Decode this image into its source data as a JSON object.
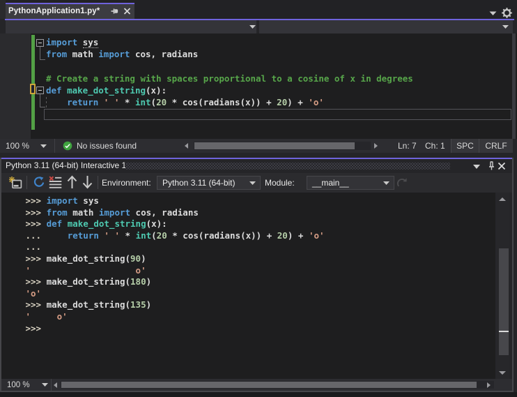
{
  "colors": {
    "accent_purple": "#6f63dc",
    "editor_background": "#1e1e1f",
    "chrome_background": "#252528",
    "keyword_blue": "#569cd6",
    "comment_green": "#57a64a",
    "string_salmon": "#d69d85",
    "number_green": "#b5cea8",
    "builtin_teal": "#4ec9b0",
    "track_changes_saved_green": "#53a045",
    "track_changes_pending_orange": "#cda53a",
    "issues_check_green": "#3fa33f"
  },
  "tab": {
    "title": "PythonApplication1.py*",
    "pin_icon": "pin-horizontal",
    "close_icon": "close-x"
  },
  "document_well": {
    "dropdown_icon": "chevron-down",
    "settings_icon": "gear"
  },
  "nav_bar": {
    "left_dropdown_value": "",
    "right_dropdown_value": ""
  },
  "editor": {
    "lines": [
      {
        "t": [
          [
            "kw",
            "import"
          ],
          [
            "pl",
            " "
          ],
          [
            "un",
            "sys"
          ]
        ]
      },
      {
        "t": [
          [
            "kw",
            "from"
          ],
          [
            "pl",
            " math "
          ],
          [
            "kw",
            "import"
          ],
          [
            "pl",
            " cos, radians"
          ]
        ]
      },
      {
        "t": []
      },
      {
        "t": [
          [
            "cm",
            "# Create a string with spaces proportional to a cosine of x in degrees"
          ]
        ]
      },
      {
        "t": [
          [
            "kw",
            "def"
          ],
          [
            "pl",
            " "
          ],
          [
            "fn",
            "make_dot_string"
          ],
          [
            "pl",
            "(x):"
          ]
        ]
      },
      {
        "t": [
          [
            "pl",
            "    "
          ],
          [
            "kw",
            "return"
          ],
          [
            "pl",
            " "
          ],
          [
            "str",
            "' '"
          ],
          [
            "pl",
            " * "
          ],
          [
            "fn",
            "int"
          ],
          [
            "pl",
            "("
          ],
          [
            "num",
            "20"
          ],
          [
            "pl",
            " * cos(radians(x)) + "
          ],
          [
            "num",
            "20"
          ],
          [
            "pl",
            ") + "
          ],
          [
            "str",
            "'o'"
          ]
        ]
      },
      {
        "t": []
      }
    ],
    "current_line_index": 7
  },
  "editor_status": {
    "zoom": "100 %",
    "issues": "No issues found",
    "line": "Ln: 7",
    "column": "Ch: 1",
    "indent_mode": "SPC",
    "line_ending": "CRLF"
  },
  "tool_window": {
    "title": "Python 3.11 (64-bit) Interactive 1",
    "toolbar": {
      "environment_label": "Environment:",
      "environment_value": "Python 3.11 (64-bit)",
      "module_label": "Module:",
      "module_value": "__main__",
      "icons": [
        "interactive-window-options",
        "reset",
        "clear-screen",
        "history-previous",
        "history-next",
        "send-to-interactive"
      ]
    }
  },
  "repl": {
    "lines": [
      {
        "t": [
          [
            "pr",
            ">>> "
          ],
          [
            "kw",
            "import"
          ],
          [
            "pl",
            " sys"
          ]
        ]
      },
      {
        "t": [
          [
            "pr",
            ">>> "
          ],
          [
            "kw",
            "from"
          ],
          [
            "pl",
            " math "
          ],
          [
            "kw",
            "import"
          ],
          [
            "pl",
            " cos, radians"
          ]
        ]
      },
      {
        "t": [
          [
            "pr",
            ">>> "
          ],
          [
            "kw",
            "def"
          ],
          [
            "pl",
            " "
          ],
          [
            "fn",
            "make_dot_string"
          ],
          [
            "pl",
            "(x):"
          ]
        ]
      },
      {
        "t": [
          [
            "pr",
            "... "
          ],
          [
            "pl",
            "    "
          ],
          [
            "kw",
            "return"
          ],
          [
            "pl",
            " "
          ],
          [
            "str",
            "' '"
          ],
          [
            "pl",
            " * "
          ],
          [
            "fn",
            "int"
          ],
          [
            "pl",
            "("
          ],
          [
            "num",
            "20"
          ],
          [
            "pl",
            " * cos(radians(x)) + "
          ],
          [
            "num",
            "20"
          ],
          [
            "pl",
            ") + "
          ],
          [
            "str",
            "'o'"
          ]
        ]
      },
      {
        "t": [
          [
            "pr",
            "..."
          ]
        ]
      },
      {
        "t": [
          [
            "pr",
            ">>> "
          ],
          [
            "pl",
            "make_dot_string("
          ],
          [
            "num",
            "90"
          ],
          [
            "pl",
            ")"
          ]
        ]
      },
      {
        "t": [
          [
            "str",
            "'                    o'"
          ]
        ]
      },
      {
        "t": [
          [
            "pr",
            ">>> "
          ],
          [
            "pl",
            "make_dot_string("
          ],
          [
            "num",
            "180"
          ],
          [
            "pl",
            ")"
          ]
        ]
      },
      {
        "t": [
          [
            "str",
            "'o'"
          ]
        ]
      },
      {
        "t": [
          [
            "pr",
            ">>> "
          ],
          [
            "pl",
            "make_dot_string("
          ],
          [
            "num",
            "135"
          ],
          [
            "pl",
            ")"
          ]
        ]
      },
      {
        "t": [
          [
            "str",
            "'     o'"
          ]
        ]
      },
      {
        "t": [
          [
            "pr",
            ">>>"
          ]
        ]
      }
    ]
  },
  "repl_status": {
    "zoom": "100 %"
  }
}
